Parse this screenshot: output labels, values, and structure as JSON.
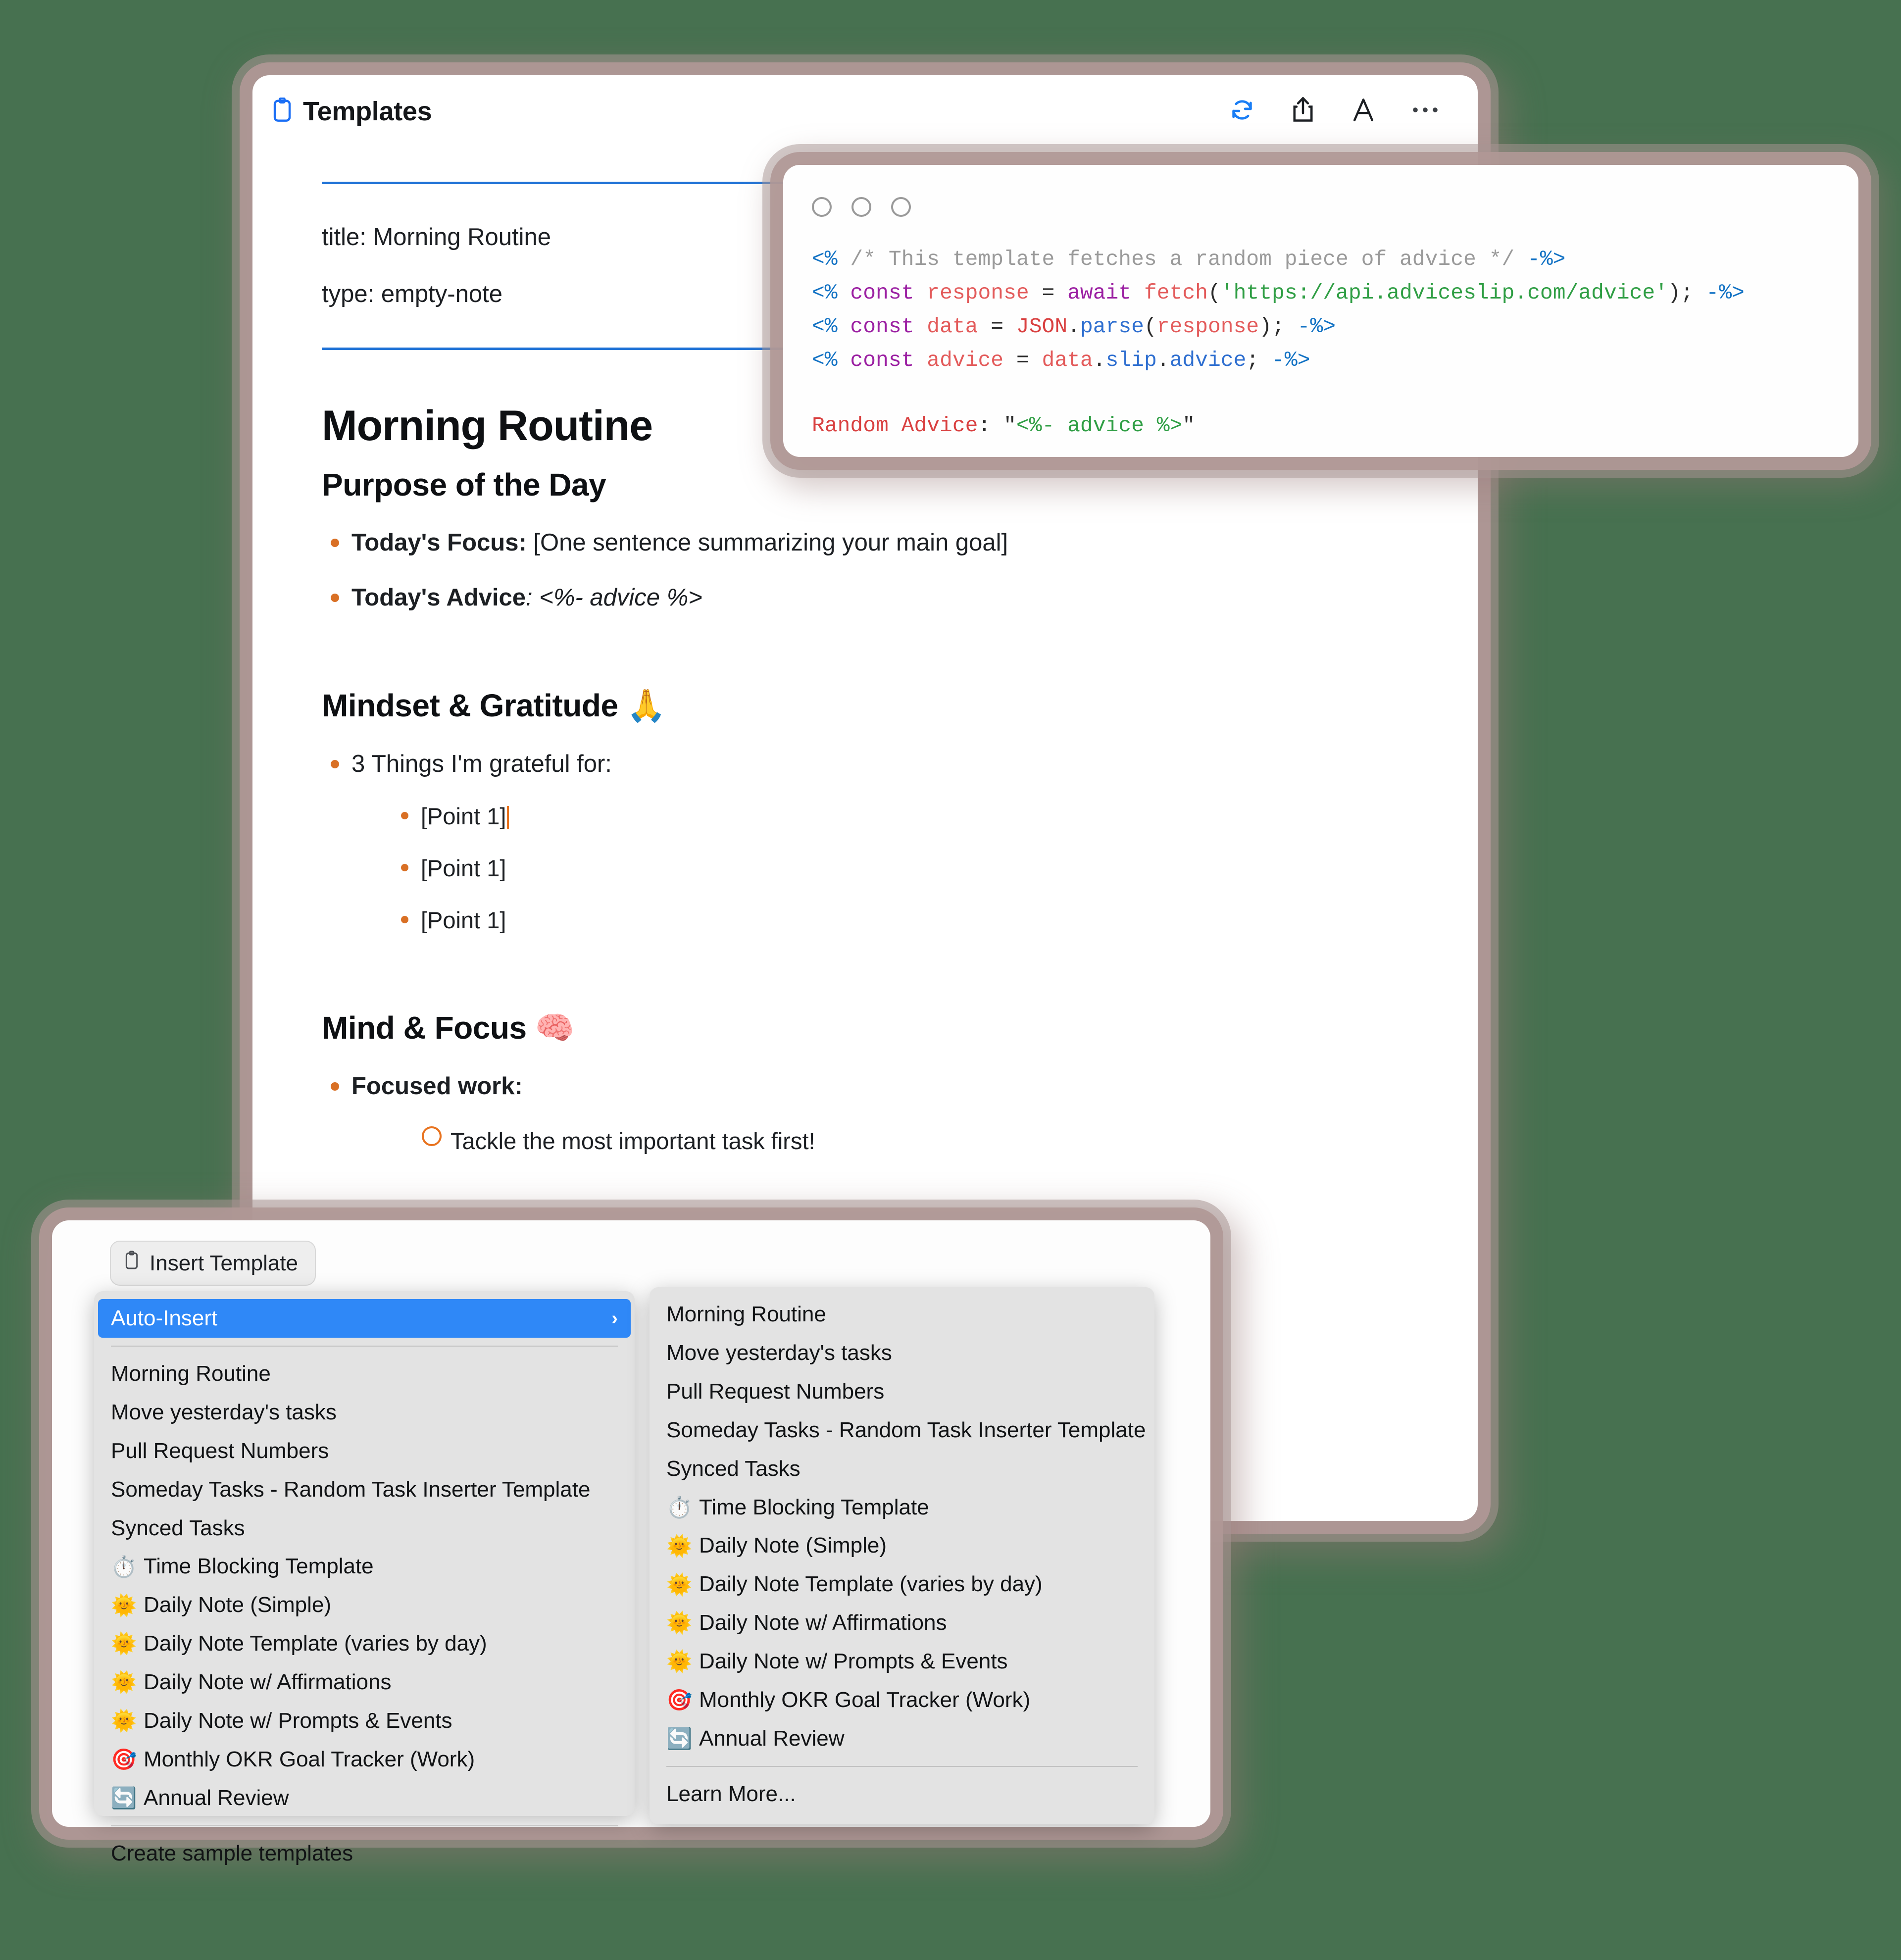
{
  "background_color": "#477150",
  "note_window": {
    "title": "Templates",
    "title_icon": "clipboard-icon",
    "actions": [
      {
        "name": "sync-icon",
        "glyph": "↻"
      },
      {
        "name": "share-icon",
        "glyph": "⇧"
      },
      {
        "name": "font-size-icon",
        "glyph": "A"
      },
      {
        "name": "more-options-icon",
        "glyph": "…"
      }
    ],
    "frontmatter": [
      "title: Morning Routine",
      "type: empty-note"
    ],
    "heading_h1": "Morning Routine",
    "sections": [
      {
        "heading": "Purpose of the Day",
        "bullets": [
          {
            "bold": "Today's Focus:",
            "rest": " [One sentence summarizing your main goal]"
          },
          {
            "bold": "Today's Advice",
            "rest": ": <%- advice %>"
          }
        ]
      },
      {
        "heading": "Mindset & Gratitude 🙏",
        "bullets": [
          {
            "bold": "",
            "rest": "3 Things I'm grateful for:"
          }
        ],
        "subbullets": [
          "[Point 1]",
          "[Point 1]",
          "[Point 1]"
        ]
      },
      {
        "heading": "Mind & Focus 🧠",
        "bullets": [
          {
            "bold": "Focused work:",
            "rest": ""
          }
        ],
        "todos": [
          "Tackle the most important task first!"
        ]
      }
    ]
  },
  "code_window": {
    "traffic_lights": [
      "close-button",
      "minimize-button",
      "maximize-button"
    ],
    "lines": [
      [
        {
          "t": "tkTag",
          "s": "<%"
        },
        {
          "t": "tkPunc",
          "s": " "
        },
        {
          "t": "tkCmt",
          "s": "/* This template fetches a random piece of advice */"
        },
        {
          "t": "tkPunc",
          "s": " "
        },
        {
          "t": "tkTag",
          "s": "-%>"
        }
      ],
      [
        {
          "t": "tkTag",
          "s": "<%"
        },
        {
          "t": "tkPunc",
          "s": " "
        },
        {
          "t": "tkKw",
          "s": "const"
        },
        {
          "t": "tkPunc",
          "s": " "
        },
        {
          "t": "tkVar",
          "s": "response"
        },
        {
          "t": "tkPunc",
          "s": " = "
        },
        {
          "t": "tkKw",
          "s": "await"
        },
        {
          "t": "tkPunc",
          "s": " "
        },
        {
          "t": "tkFn",
          "s": "fetch"
        },
        {
          "t": "tkPunc",
          "s": "("
        },
        {
          "t": "tkStr",
          "s": "'https://api.adviceslip.com/advice'"
        },
        {
          "t": "tkPunc",
          "s": "); "
        },
        {
          "t": "tkTag",
          "s": "-%>"
        }
      ],
      [
        {
          "t": "tkTag",
          "s": "<%"
        },
        {
          "t": "tkPunc",
          "s": " "
        },
        {
          "t": "tkKw",
          "s": "const"
        },
        {
          "t": "tkPunc",
          "s": " "
        },
        {
          "t": "tkVar",
          "s": "data"
        },
        {
          "t": "tkPunc",
          "s": " = "
        },
        {
          "t": "tkConst",
          "s": "JSON"
        },
        {
          "t": "tkPunc",
          "s": "."
        },
        {
          "t": "tkProp",
          "s": "parse"
        },
        {
          "t": "tkPunc",
          "s": "("
        },
        {
          "t": "tkVar",
          "s": "response"
        },
        {
          "t": "tkPunc",
          "s": "); "
        },
        {
          "t": "tkTag",
          "s": "-%>"
        }
      ],
      [
        {
          "t": "tkTag",
          "s": "<%"
        },
        {
          "t": "tkPunc",
          "s": " "
        },
        {
          "t": "tkKw",
          "s": "const"
        },
        {
          "t": "tkPunc",
          "s": " "
        },
        {
          "t": "tkVar",
          "s": "advice"
        },
        {
          "t": "tkPunc",
          "s": " = "
        },
        {
          "t": "tkVar",
          "s": "data"
        },
        {
          "t": "tkPunc",
          "s": "."
        },
        {
          "t": "tkProp",
          "s": "slip"
        },
        {
          "t": "tkPunc",
          "s": "."
        },
        {
          "t": "tkProp",
          "s": "advice"
        },
        {
          "t": "tkPunc",
          "s": "; "
        },
        {
          "t": "tkTag",
          "s": "-%>"
        }
      ],
      [],
      [
        {
          "t": "tkConst",
          "s": "Random Advice"
        },
        {
          "t": "tkPunc",
          "s": ": \""
        },
        {
          "t": "tkStr",
          "s": "<%- advice %>"
        },
        {
          "t": "tkPunc",
          "s": "\""
        }
      ]
    ]
  },
  "insert_button": {
    "label": "Insert Template",
    "icon": "clipboard-icon"
  },
  "context_menu": {
    "items": [
      {
        "label": "Auto-Insert",
        "emoji": "",
        "selected": true,
        "submenu": true
      },
      {
        "separator": true
      },
      {
        "label": "Morning Routine",
        "emoji": ""
      },
      {
        "label": "Move yesterday's tasks",
        "emoji": ""
      },
      {
        "label": "Pull Request Numbers",
        "emoji": ""
      },
      {
        "label": "Someday Tasks - Random Task Inserter Template",
        "emoji": ""
      },
      {
        "label": "Synced Tasks",
        "emoji": ""
      },
      {
        "label": "Time Blocking Template",
        "emoji": "⏱️"
      },
      {
        "label": "Daily Note (Simple)",
        "emoji": "🌞"
      },
      {
        "label": "Daily Note Template (varies by day)",
        "emoji": "🌞"
      },
      {
        "label": "Daily Note w/ Affirmations",
        "emoji": "🌞"
      },
      {
        "label": "Daily Note w/ Prompts & Events",
        "emoji": "🌞"
      },
      {
        "label": "Monthly OKR Goal Tracker (Work)",
        "emoji": "🎯"
      },
      {
        "label": "Annual Review",
        "emoji": "🔄"
      },
      {
        "separator": true
      },
      {
        "label": "Create sample templates",
        "emoji": ""
      }
    ],
    "submenu_items": [
      {
        "label": "Morning Routine",
        "emoji": ""
      },
      {
        "label": "Move yesterday's tasks",
        "emoji": ""
      },
      {
        "label": "Pull Request Numbers",
        "emoji": ""
      },
      {
        "label": "Someday Tasks - Random Task Inserter Template",
        "emoji": ""
      },
      {
        "label": "Synced Tasks",
        "emoji": ""
      },
      {
        "label": "Time Blocking Template",
        "emoji": "⏱️"
      },
      {
        "label": "Daily Note (Simple)",
        "emoji": "🌞"
      },
      {
        "label": "Daily Note Template (varies by day)",
        "emoji": "🌞"
      },
      {
        "label": "Daily Note w/ Affirmations",
        "emoji": "🌞"
      },
      {
        "label": "Daily Note w/ Prompts & Events",
        "emoji": "🌞"
      },
      {
        "label": "Monthly OKR Goal Tracker (Work)",
        "emoji": "🎯"
      },
      {
        "label": "Annual Review",
        "emoji": "🔄"
      },
      {
        "separator": true
      },
      {
        "label": "Learn More...",
        "emoji": ""
      }
    ]
  },
  "colors": {
    "accent_blue": "#1f72d6",
    "bullet_orange": "#d97025",
    "selection_blue": "#2f88f7",
    "shadow_mauve": "#b09896"
  }
}
